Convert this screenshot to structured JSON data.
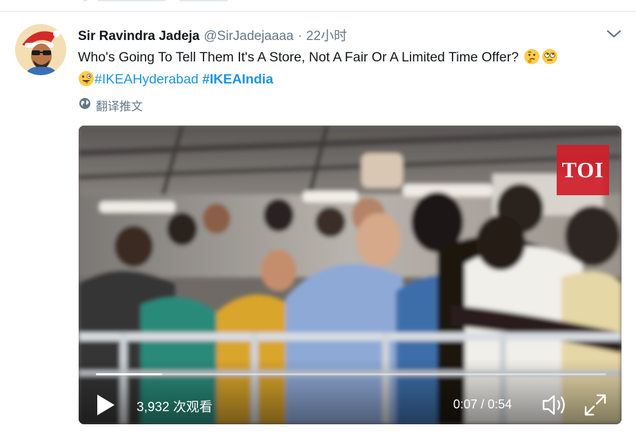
{
  "tweet": {
    "display_name": "Sir Ravindra Jadeja",
    "handle": "@SirJadejaaaa",
    "separator": "·",
    "time": "22小时",
    "text_part1": "Who's Going To Tell Them It's A Store, Not A Fair Or A Limited Time Offer?",
    "hashtag1": "#IKEAHyderabad",
    "hashtag2": "#IKEAIndia",
    "emojis": [
      "thinking-face-emoji",
      "face-with-rolling-eyes-emoji",
      "zany-face-emoji"
    ],
    "translate_label": "翻译推文"
  },
  "video": {
    "watermark": "TOI",
    "views": "3,932 次观看",
    "time_display": "0:07 / 0:54",
    "progress_fraction": 0.13
  },
  "colors": {
    "link": "#1b95e0",
    "text": "#14171a",
    "muted": "#657786",
    "background": "#e6ecf0",
    "watermark_red": "#d1202b"
  }
}
